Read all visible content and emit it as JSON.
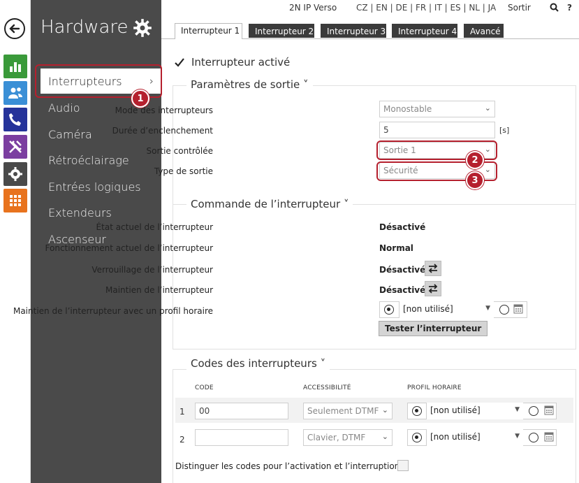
{
  "topbar": {
    "device": "2N IP Verso",
    "languages": "CZ | EN | DE | FR | IT | ES | NL | JA",
    "logout": "Sortir",
    "help": "?"
  },
  "rail": {
    "icons": [
      "chart-icon",
      "users-icon",
      "phone-icon",
      "tools-icon",
      "gear-icon",
      "grid-icon"
    ],
    "colors": [
      "#3a9a3a",
      "#3a8fd6",
      "#25339a",
      "#7b3ea0",
      "#4a4a4a",
      "#e8731e"
    ]
  },
  "sidebar": {
    "title": "Hardware",
    "items": [
      "Interrupteurs",
      "Audio",
      "Caméra",
      "Rétroéclairage",
      "Entrées logiques",
      "Extendeurs",
      "Ascenseur"
    ],
    "active_chevron": "›"
  },
  "badges": [
    "1",
    "2",
    "3"
  ],
  "tabs": [
    "Interrupteur 1",
    "Interrupteur 2",
    "Interrupteur 3",
    "Interrupteur 4",
    "Avancé"
  ],
  "switch_enabled": {
    "label": "Interrupteur activé",
    "checked": true
  },
  "output": {
    "title": "Paramètres de sortie ˅",
    "mode_label": "Mode des interrupteurs",
    "mode_value": "Monostable",
    "duration_label": "Durée d’enclenchement",
    "duration_value": "5",
    "duration_unit": "[s]",
    "controlled_label": "Sortie contrôlée",
    "controlled_value": "Sortie 1",
    "type_label": "Type de sortie",
    "type_value": "Sécurité"
  },
  "command": {
    "title": "Commande de l’interrupteur ˅",
    "state_label": "État actuel de l’interrupteur",
    "state_value": "Désactivé",
    "function_label": "Fonctionnement actuel de l’interrupteur",
    "function_value": "Normal",
    "lock_label": "Verrouillage de l’interrupteur",
    "lock_value": "Désactivé",
    "hold_label": "Maintien de l’interrupteur",
    "hold_value": "Désactivé",
    "profile_label": "Maintien de l’interrupteur avec un profil horaire",
    "profile_value": "[non utilisé]",
    "test_button": "Tester l’interrupteur"
  },
  "codes": {
    "title": "Codes des interrupteurs ˅",
    "col_code": "CODE",
    "col_access": "ACCESSIBILITÉ",
    "col_profile": "PROFIL HORAIRE",
    "rows": [
      {
        "num": "1",
        "code": "00",
        "access": "Seulement DTMF",
        "profile": "[non utilisé]"
      },
      {
        "num": "2",
        "code": "",
        "access": "Clavier, DTMF",
        "profile": "[non utilisé]"
      }
    ],
    "distinguish_label": "Distinguer les codes pour l’activation et l’interruption"
  }
}
